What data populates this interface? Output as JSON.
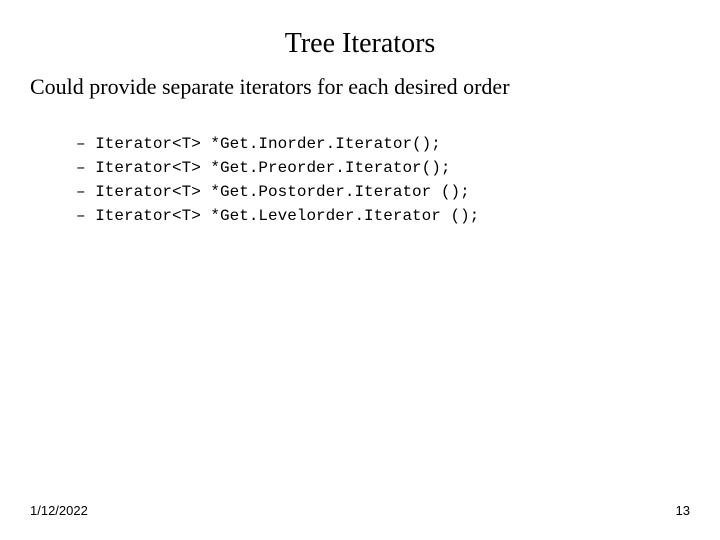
{
  "title": "Tree Iterators",
  "body": "Could provide separate iterators for each desired order",
  "code": {
    "line1": "– Iterator<T> *Get.Inorder.Iterator();",
    "line2": "– Iterator<T> *Get.Preorder.Iterator();",
    "line3": "– Iterator<T> *Get.Postorder.Iterator ();",
    "line4": "– Iterator<T> *Get.Levelorder.Iterator ();"
  },
  "footer": {
    "date": "1/12/2022",
    "page": "13"
  }
}
